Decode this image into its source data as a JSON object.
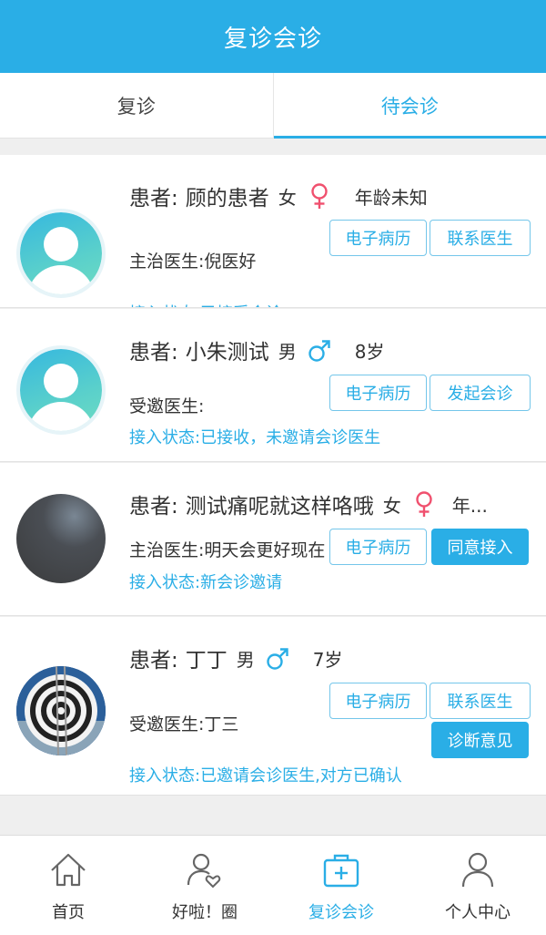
{
  "header": {
    "title": "复诊会诊"
  },
  "tabs": [
    {
      "label": "复诊",
      "active": false
    },
    {
      "label": "待会诊",
      "active": true
    }
  ],
  "colors": {
    "accent": "#2aaee6",
    "female": "#f0506e"
  },
  "patients": [
    {
      "patient_label": "患者:",
      "name": "顾的患者",
      "gender": "女",
      "gender_icon": "female-icon",
      "age": "年龄未知",
      "doctor": "主治医生:倪医好",
      "status": "接入状态:已接受会诊",
      "buttons": [
        "电子病历",
        "联系医生"
      ]
    },
    {
      "patient_label": "患者:",
      "name": "小朱测试",
      "gender": "男",
      "gender_icon": "male-icon",
      "age": "8岁",
      "doctor": "受邀医生:",
      "status": "接入状态:已接收，未邀请会诊医生",
      "buttons": [
        "电子病历",
        "发起会诊"
      ]
    },
    {
      "patient_label": "患者:",
      "name": "测试痛呢就这样咯哦",
      "gender": "女",
      "gender_icon": "female-icon",
      "age": "年...",
      "doctor": "主治医生:明天会更好现在",
      "status": "接入状态:新会诊邀请",
      "buttons": [
        "电子病历",
        "同意接入"
      ]
    },
    {
      "patient_label": "患者:",
      "name": "丁丁",
      "gender": "男",
      "gender_icon": "male-icon",
      "age": "7岁",
      "doctor": "受邀医生:丁三",
      "status": "接入状态:已邀请会诊医生,对方已确认",
      "buttons": [
        "电子病历",
        "联系医生",
        "诊断意见"
      ]
    }
  ],
  "bottom_nav": [
    {
      "label": "首页",
      "icon": "home-icon",
      "active": false
    },
    {
      "label": "好啦！圈",
      "icon": "user-heart-icon",
      "active": false
    },
    {
      "label": "复诊会诊",
      "icon": "medical-kit-icon",
      "active": true
    },
    {
      "label": "个人中心",
      "icon": "person-icon",
      "active": false
    }
  ]
}
